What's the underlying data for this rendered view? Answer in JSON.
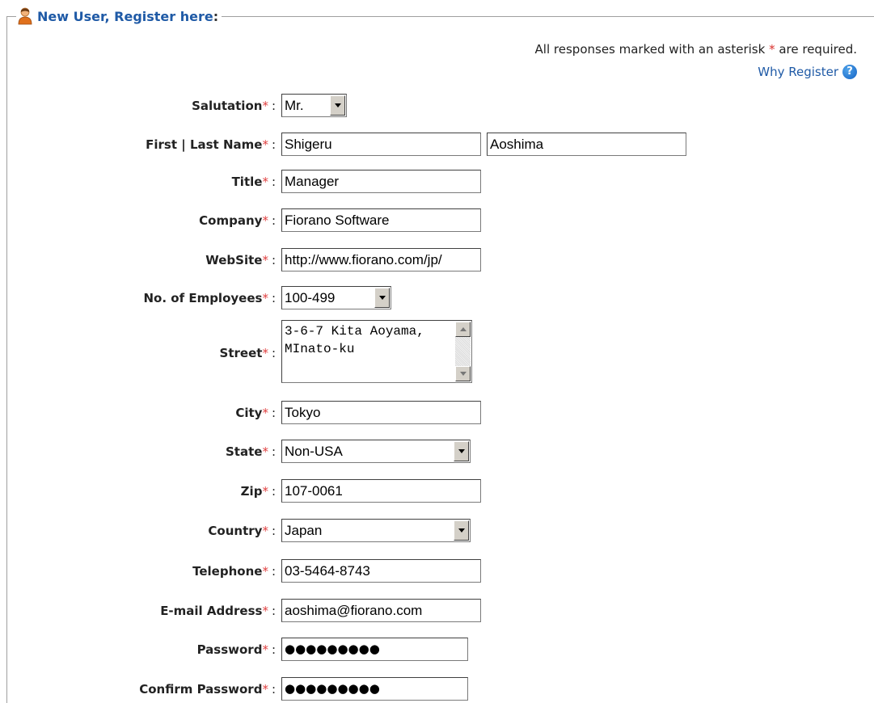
{
  "legend": {
    "title": "New User, Register here",
    "colon": ":"
  },
  "required_note": {
    "before": "All responses marked with an asterisk",
    "asterisk": "*",
    "after": "are required."
  },
  "why_register": {
    "label": "Why Register",
    "icon": "?"
  },
  "colors": {
    "accent": "#1f5aa6",
    "required": "#e04040"
  },
  "fields": {
    "salutation": {
      "label": "Salutation",
      "value": "Mr."
    },
    "name": {
      "label": "First | Last Name",
      "first": "Shigeru",
      "last": "Aoshima"
    },
    "title": {
      "label": "Title",
      "value": "Manager"
    },
    "company": {
      "label": "Company",
      "value": "Fiorano Software"
    },
    "website": {
      "label": "WebSite",
      "value": "http://www.fiorano.com/jp/"
    },
    "employees": {
      "label": "No. of Employees",
      "value": "100-499"
    },
    "street": {
      "label": "Street",
      "value": "3-6-7 Kita Aoyama, MInato-ku"
    },
    "city": {
      "label": "City",
      "value": "Tokyo"
    },
    "state": {
      "label": "State",
      "value": "Non-USA"
    },
    "zip": {
      "label": "Zip",
      "value": "107-0061"
    },
    "country": {
      "label": "Country",
      "value": "Japan"
    },
    "telephone": {
      "label": "Telephone",
      "value": "03-5464-8743"
    },
    "email": {
      "label": "E-mail Address",
      "value": "aoshima@fiorano.com"
    },
    "password": {
      "label": "Password",
      "value": "●●●●●●●●●"
    },
    "confirm_password": {
      "label": "Confirm Password",
      "value": "●●●●●●●●●"
    }
  },
  "asterisk": "*",
  "colon": ":"
}
